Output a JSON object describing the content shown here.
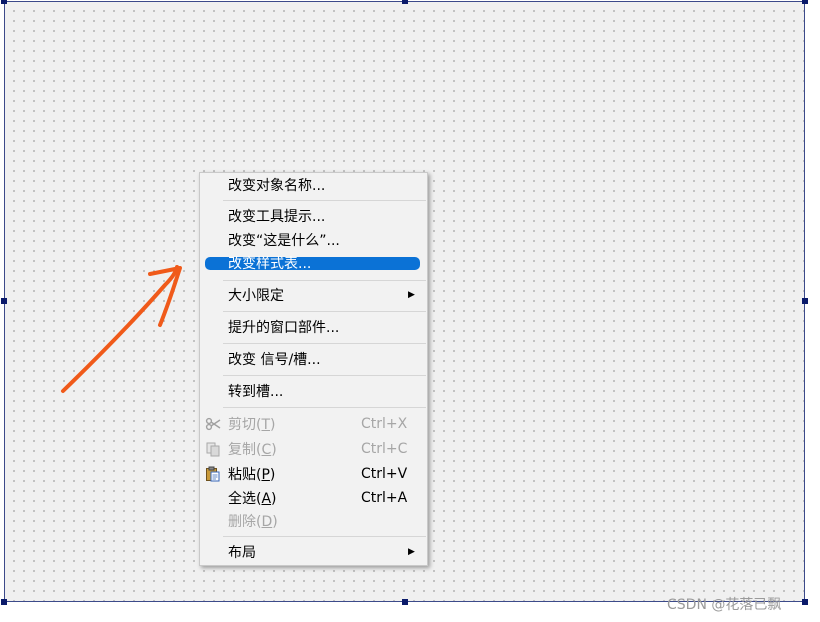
{
  "menu": {
    "items": [
      {
        "label": "改变对象名称..."
      },
      {
        "label": "改变工具提示..."
      },
      {
        "label": "改变“这是什么”..."
      },
      {
        "label": "改变样式表..."
      },
      {
        "label": "大小限定"
      },
      {
        "label": "提升的窗口部件..."
      },
      {
        "label": "改变 信号/槽..."
      },
      {
        "label": "转到槽..."
      },
      {
        "label_pre": "剪切(",
        "mnemonic": "T",
        "label_post": ")",
        "shortcut": "Ctrl+X"
      },
      {
        "label_pre": "复制(",
        "mnemonic": "C",
        "label_post": ")",
        "shortcut": "Ctrl+C"
      },
      {
        "label_pre": "粘贴(",
        "mnemonic": "P",
        "label_post": ")",
        "shortcut": "Ctrl+V"
      },
      {
        "label_pre": "全选(",
        "mnemonic": "A",
        "label_post": ")",
        "shortcut": "Ctrl+A"
      },
      {
        "label_pre": "删除(",
        "mnemonic": "D",
        "label_post": ")"
      },
      {
        "label": "布局"
      }
    ]
  },
  "icons": {
    "cut": "scissors-icon",
    "copy": "copy-icon",
    "paste": "paste-icon",
    "submenu": "chevron-right-icon"
  },
  "colors": {
    "highlight": "#0b72d6",
    "annotation_arrow": "#f05a1a",
    "disabled_text": "#a6a6a6"
  },
  "watermark": "CSDN @花落已飘"
}
